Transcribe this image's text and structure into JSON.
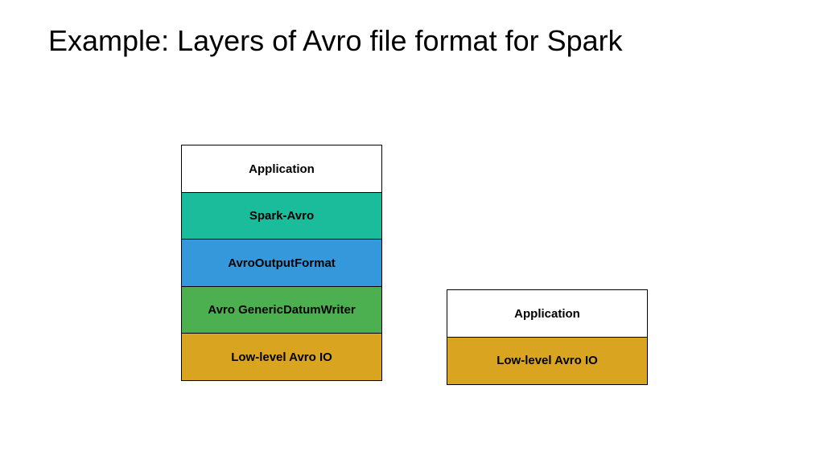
{
  "title": "Example: Layers of Avro file format for Spark",
  "stacks": {
    "left": {
      "layers": [
        {
          "label": "Application",
          "color": "white"
        },
        {
          "label": "Spark-Avro",
          "color": "teal"
        },
        {
          "label": "AvroOutputFormat",
          "color": "blue"
        },
        {
          "label": "Avro GenericDatumWriter",
          "color": "green"
        },
        {
          "label": "Low-level Avro IO",
          "color": "gold"
        }
      ]
    },
    "right": {
      "layers": [
        {
          "label": "Application",
          "color": "white"
        },
        {
          "label": "Low-level Avro IO",
          "color": "gold"
        }
      ]
    }
  }
}
